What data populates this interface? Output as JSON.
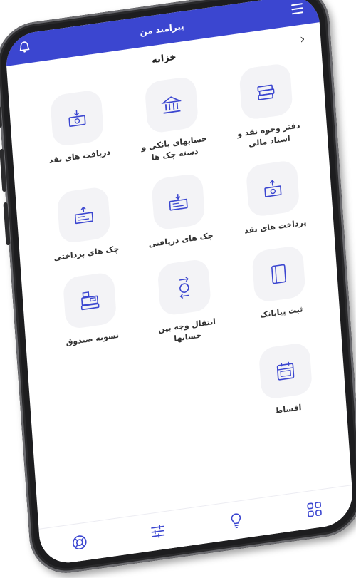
{
  "appbar": {
    "title": "پیرامید من",
    "menu_icon": "hamburger-icon",
    "notification_icon": "bell-icon"
  },
  "page": {
    "title": "خزانه",
    "back_icon": "chevron-right-icon"
  },
  "tiles": [
    {
      "label": "دفتر وجوه نقد و اسناد مالی",
      "icon": "cash-stack-icon"
    },
    {
      "label": "حسابهای بانکی و دسته چک ها",
      "icon": "bank-icon"
    },
    {
      "label": "دریافت های نقد",
      "icon": "cash-receive-icon"
    },
    {
      "label": "پرداخت های نقد",
      "icon": "cash-pay-icon"
    },
    {
      "label": "چک های دریافتی",
      "icon": "check-receive-icon"
    },
    {
      "label": "چک های پرداختی",
      "icon": "check-pay-icon"
    },
    {
      "label": "ثبت پیابانک",
      "icon": "card-icon"
    },
    {
      "label": "انتقال وجه بین حسابها",
      "icon": "transfer-icon"
    },
    {
      "label": "تسویه صندوق",
      "icon": "cash-register-icon"
    },
    {
      "label": "اقساط",
      "icon": "calendar-icon"
    }
  ],
  "bottom_nav": [
    {
      "icon": "grid-icon"
    },
    {
      "icon": "lightbulb-icon"
    },
    {
      "icon": "sliders-icon"
    },
    {
      "icon": "lifebuoy-icon"
    }
  ],
  "colors": {
    "primary": "#3b46d0",
    "tile_bg": "#f3f3f6",
    "icon": "#3b46d0"
  }
}
